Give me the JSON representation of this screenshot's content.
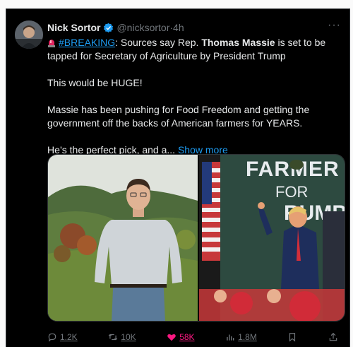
{
  "tweet": {
    "author_name": "Nick Sortor",
    "handle": "@nicksortor",
    "separator": "·",
    "time": "4h",
    "more": "···",
    "line1_hashtag": "#BREAKING",
    "line1_a": ": Sources say Rep. ",
    "line1_bold": "Thomas Massie",
    "line1_b": " is set to be tapped for Secretary of Agriculture by President Trump",
    "para2": "This would be HUGE!",
    "para3": "Massie has been pushing for Food Freedom and getting the government off the backs of American farmers for YEARS.",
    "para4": "He’s the perfect pick, and a...",
    "show_more": "Show more"
  },
  "media": {
    "right_sign_line1": "FARMER",
    "right_sign_line2": "FOR",
    "right_sign_line3": "RUMP"
  },
  "actions": {
    "replies": "1.2K",
    "reposts": "10K",
    "likes": "58K",
    "views": "1.8M"
  },
  "colors": {
    "background": "#000000",
    "accent": "#1d9bf0",
    "like": "#f91880",
    "muted": "#71767b"
  },
  "icons": [
    "avatar",
    "verified-badge-icon",
    "siren-emoji-icon",
    "more-icon",
    "reply-icon",
    "repost-icon",
    "like-icon",
    "views-icon",
    "bookmark-icon",
    "share-icon"
  ]
}
